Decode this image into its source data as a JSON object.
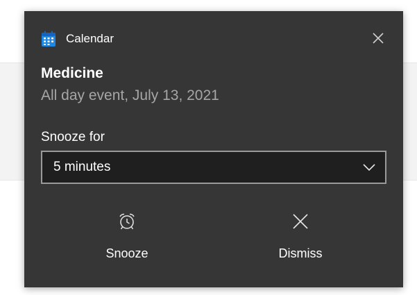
{
  "notification": {
    "app_name": "Calendar",
    "app_icon": "calendar-icon",
    "title": "Medicine",
    "subtitle": "All day event, July 13, 2021",
    "close_icon": "close-icon",
    "accent_color": "#1e88e5",
    "background_color": "#363636"
  },
  "snooze": {
    "label": "Snooze for",
    "selected_value": "5 minutes",
    "dropdown_icon": "chevron-down-icon"
  },
  "actions": [
    {
      "label": "Snooze",
      "icon": "alarm-clock-icon"
    },
    {
      "label": "Dismiss",
      "icon": "close-icon"
    }
  ]
}
